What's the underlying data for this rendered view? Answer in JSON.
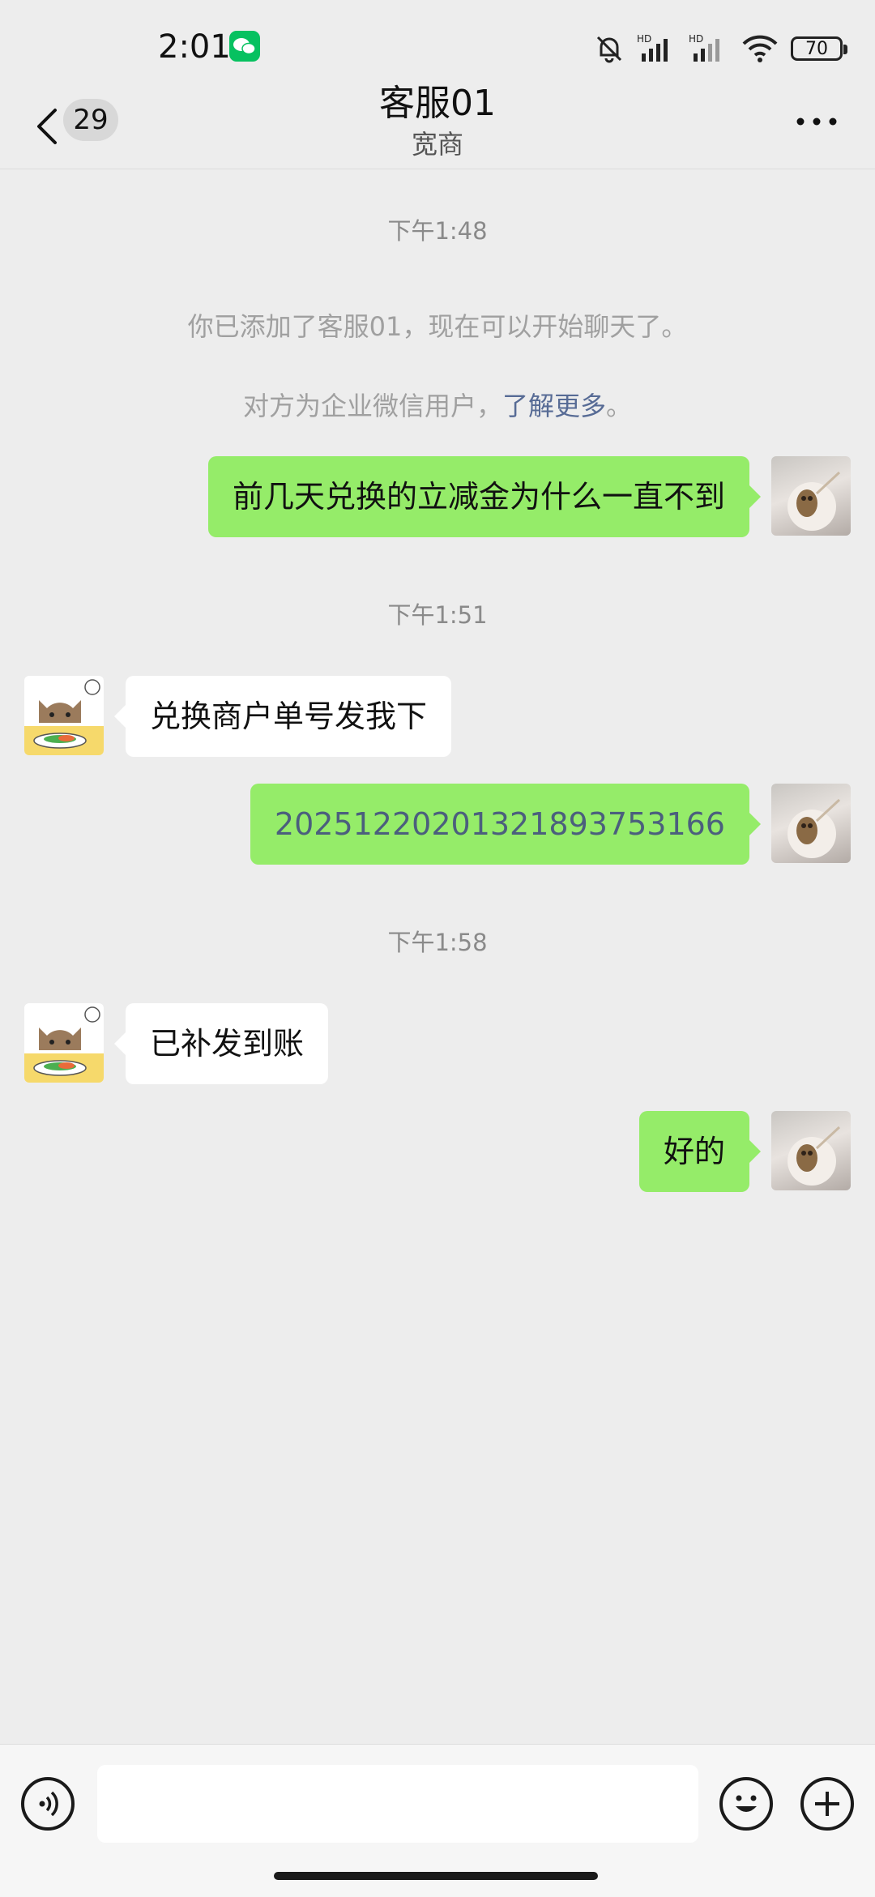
{
  "status_bar": {
    "time": "2:01",
    "battery": "70",
    "icons": [
      "wechat-icon",
      "mute-bell-icon",
      "hd-signal-icon",
      "hd-signal-icon",
      "wifi-icon",
      "battery-icon"
    ]
  },
  "nav": {
    "unread_count": "29",
    "title": "客服01",
    "subtitle": "宽商"
  },
  "messages": {
    "ts1": "下午1:48",
    "sys1": "你已添加了客服01，现在可以开始聊天了。",
    "sys2_prefix": "对方为企业微信用户，",
    "sys2_link": "了解更多",
    "sys2_suffix": "。",
    "m1": "前几天兑换的立减金为什么一直不到",
    "ts2": "下午1:51",
    "m2": "兑换商户单号发我下",
    "m3": "2025122020132189375316​6",
    "ts3": "下午1:58",
    "m4": "已补发到账",
    "m5": "好的"
  },
  "input_bar": {
    "placeholder": ""
  }
}
